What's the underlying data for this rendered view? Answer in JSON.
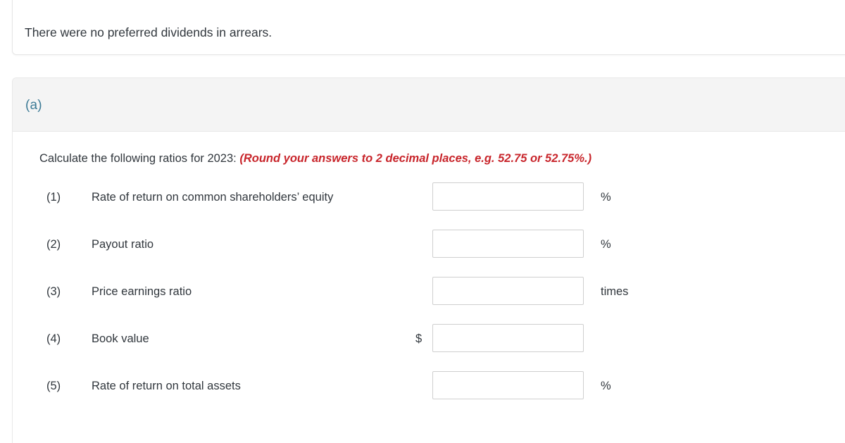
{
  "info_card": {
    "text": "There were no preferred dividends in arrears."
  },
  "part": {
    "label": "(a)",
    "instruction_prefix": "Calculate the following ratios for 2023: ",
    "instruction_emphasis": "(Round your answers to 2 decimal places, e.g. 52.75 or 52.75%.)"
  },
  "rows": [
    {
      "number": "(1)",
      "label": "Rate of return on common shareholders’ equity",
      "prefix": "",
      "value": "",
      "placeholder": "",
      "unit": "%"
    },
    {
      "number": "(2)",
      "label": "Payout ratio",
      "prefix": "",
      "value": "",
      "placeholder": "",
      "unit": "%"
    },
    {
      "number": "(3)",
      "label": "Price earnings ratio",
      "prefix": "",
      "value": "",
      "placeholder": "",
      "unit": "times"
    },
    {
      "number": "(4)",
      "label": "Book value",
      "prefix": "$",
      "value": "",
      "placeholder": "",
      "unit": ""
    },
    {
      "number": "(5)",
      "label": "Rate of return on total assets",
      "prefix": "",
      "value": "",
      "placeholder": "",
      "unit": "%"
    }
  ],
  "colors": {
    "accent": "#3d7b96",
    "emphasis": "#c8252b",
    "text": "#31373d",
    "panel_gray": "#f4f4f4",
    "border": "#e8e8e8",
    "input_border": "#cfcfcf"
  }
}
